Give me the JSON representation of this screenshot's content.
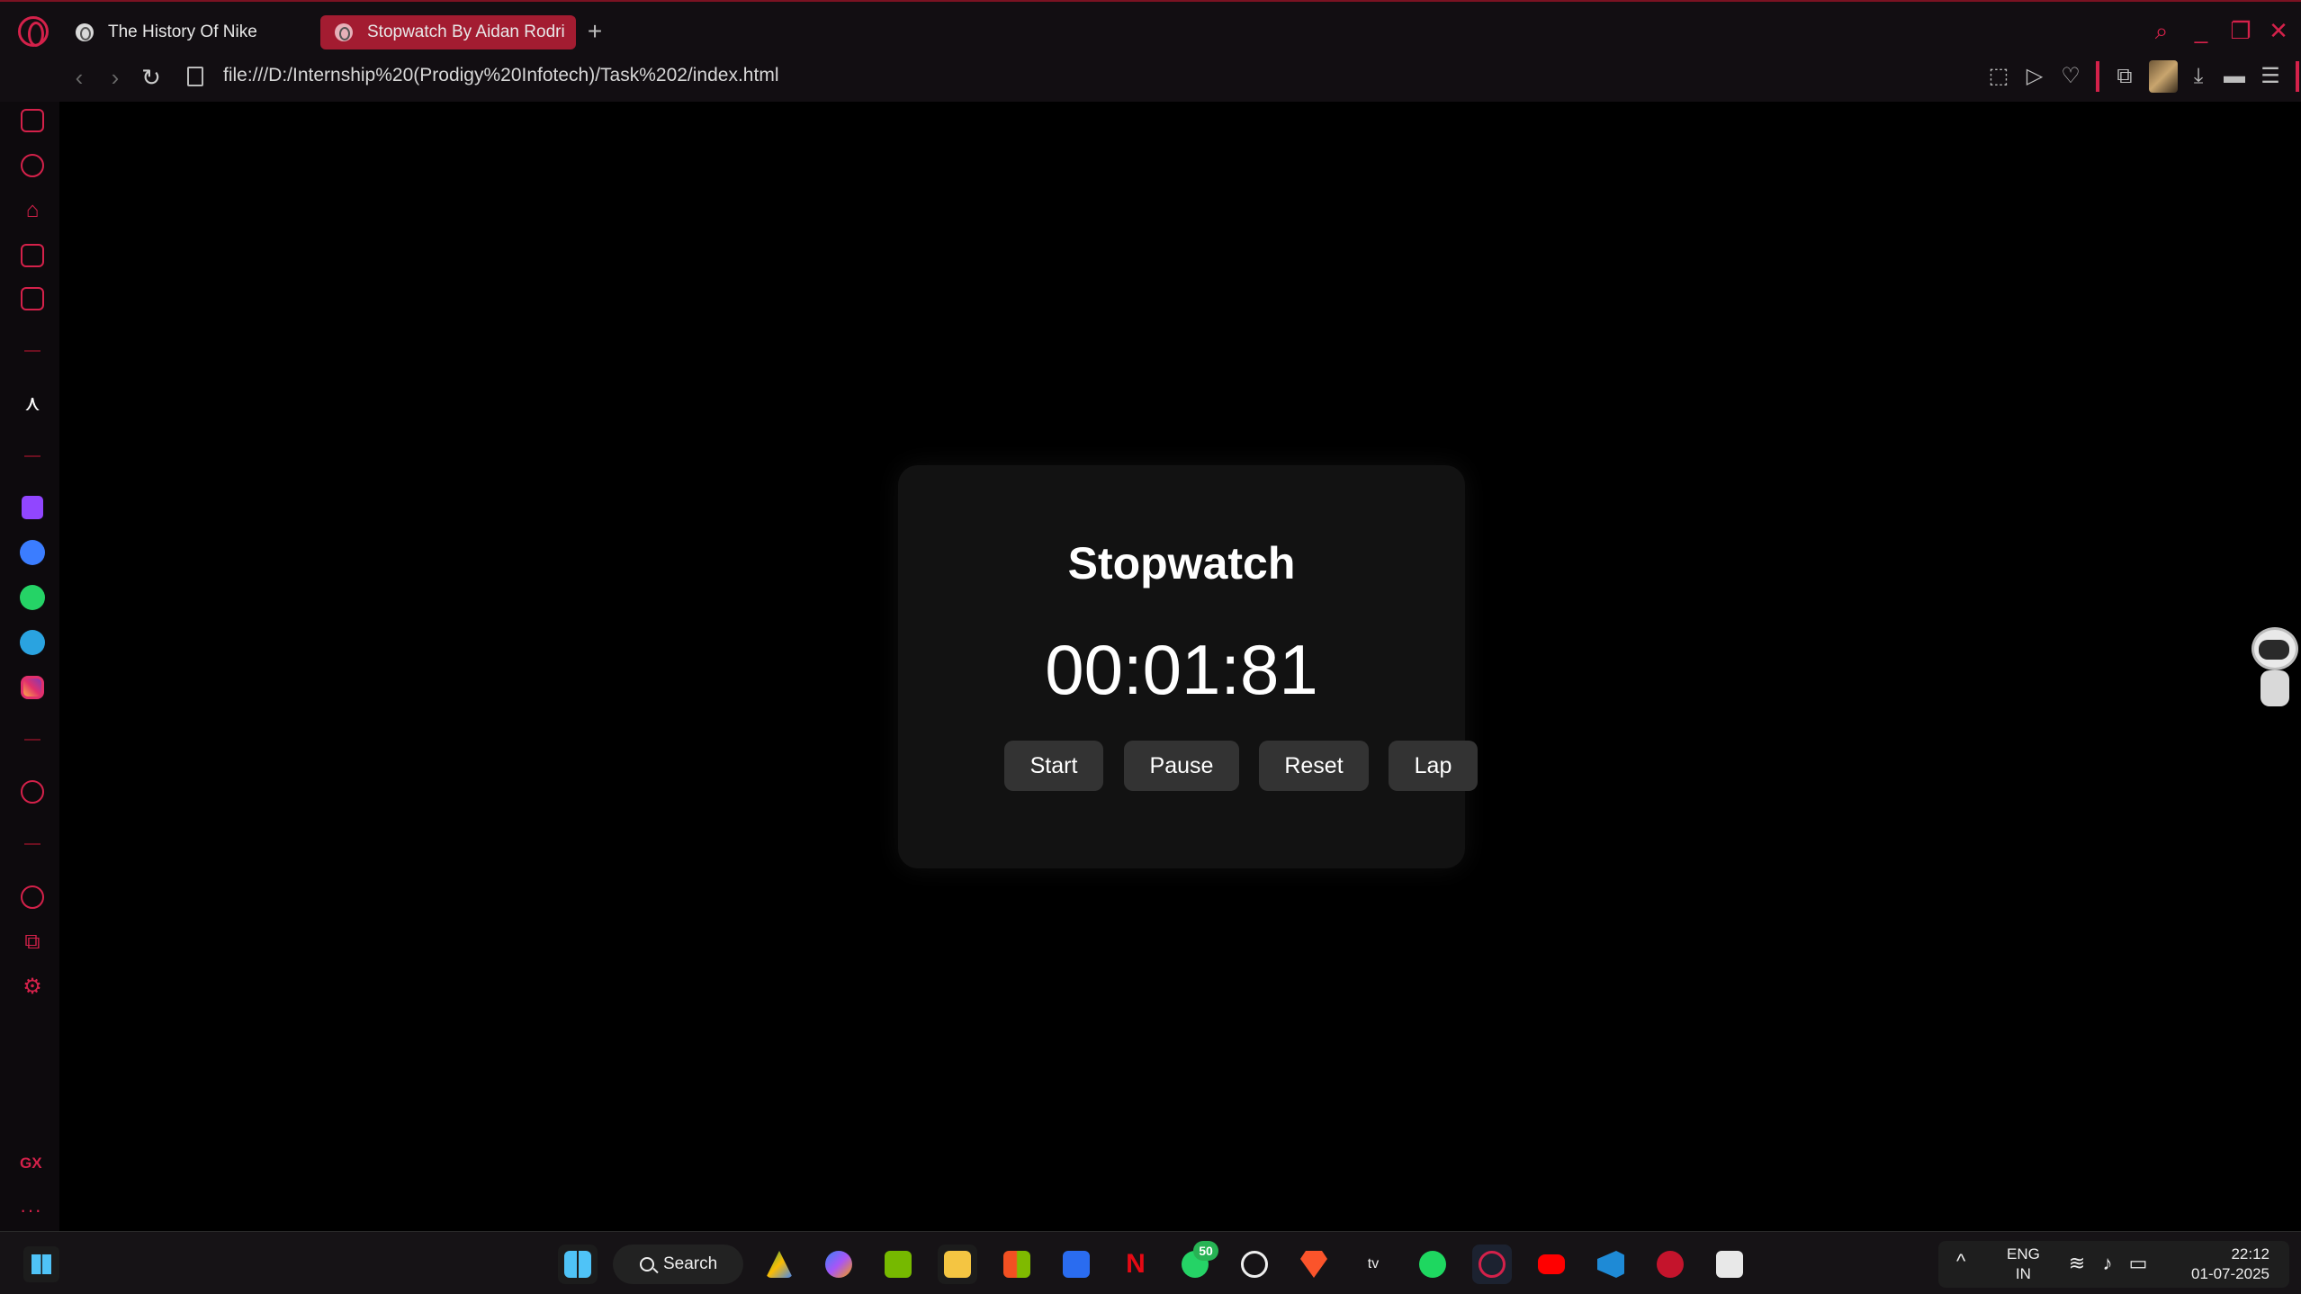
{
  "browser": {
    "tabs": [
      {
        "title": "The History Of Nike",
        "active": false
      },
      {
        "title": "Stopwatch By Aidan Rodri",
        "active": true
      }
    ],
    "new_tab_label": "+",
    "url": "file:///D:/Internship%20(Prodigy%20Infotech)/Task%202/index.html",
    "accent_color": "#d4214a"
  },
  "sidebar": {
    "gx_label": "GX",
    "more_label": "···"
  },
  "stopwatch": {
    "title": "Stopwatch",
    "time": "00:01:81",
    "buttons": {
      "start": "Start",
      "pause": "Pause",
      "reset": "Reset",
      "lap": "Lap"
    }
  },
  "taskbar": {
    "search_label": "Search",
    "whatsapp_badge": "50",
    "language_line1": "ENG",
    "language_line2": "IN",
    "time": "22:12",
    "date": "01-07-2025"
  }
}
